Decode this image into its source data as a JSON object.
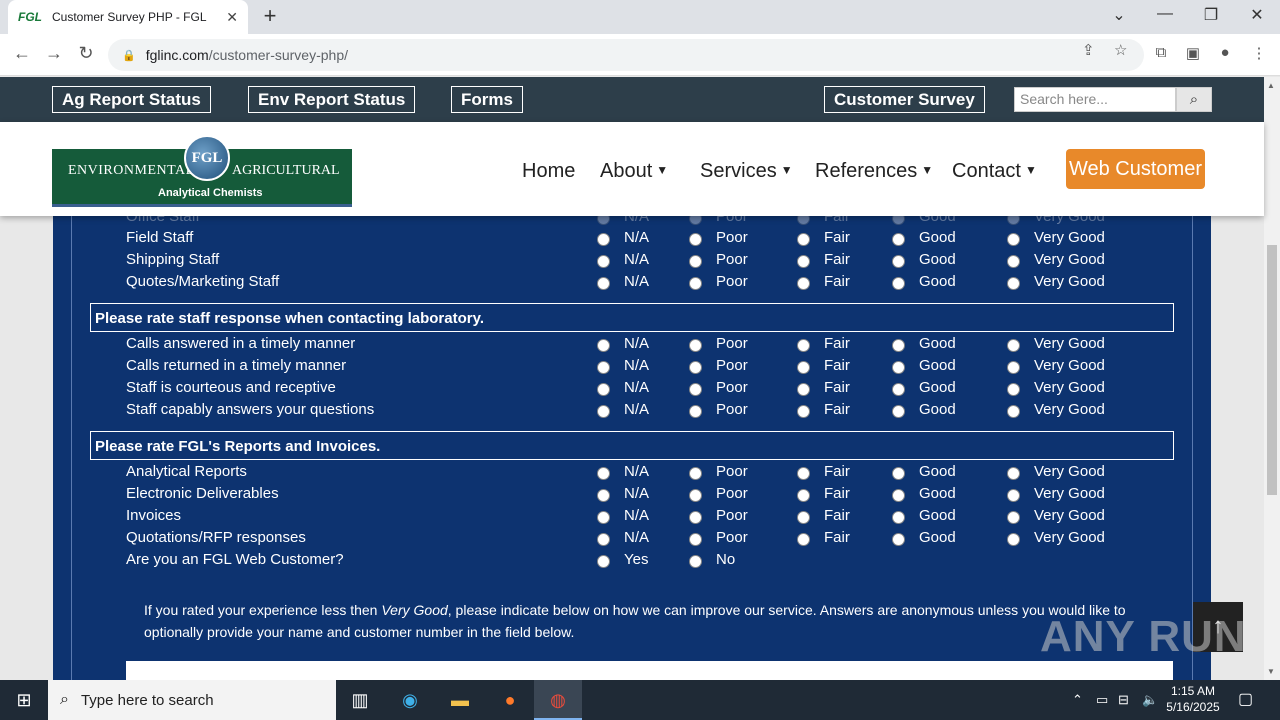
{
  "browser": {
    "tab_title": "Customer Survey PHP - FGL",
    "tab_favicon_text": "FGL",
    "url_domain": "fglinc.com",
    "url_path": "/customer-survey-php/"
  },
  "topbar": {
    "buttons": [
      "Ag Report Status",
      "Env Report Status",
      "Forms",
      "Customer Survey"
    ],
    "search_placeholder": "Search here..."
  },
  "header": {
    "logo": {
      "left": "ENVIRONMENTAL",
      "right": "AGRICULTURAL",
      "sub": "Analytical Chemists",
      "badge": "FGL"
    },
    "nav": [
      "Home",
      "About",
      "Services",
      "References",
      "Contact"
    ],
    "cta": "Web Customer"
  },
  "survey": {
    "options": [
      "N/A",
      "Poor",
      "Fair",
      "Good",
      "Very Good"
    ],
    "partial_row": {
      "label": "Office Staff"
    },
    "group1_rows": [
      "Field Staff",
      "Shipping Staff",
      "Quotes/Marketing Staff"
    ],
    "section2": "Please rate staff response when contacting laboratory.",
    "group2_rows": [
      "Calls answered in a timely manner",
      "Calls returned in a timely manner",
      "Staff is courteous and receptive",
      "Staff capably answers your questions"
    ],
    "section3": "Please rate FGL's Reports and Invoices.",
    "group3_rows": [
      "Analytical Reports",
      "Electronic Deliverables",
      "Invoices",
      "Quotations/RFP responses"
    ],
    "web_customer_q": "Are you an FGL Web Customer?",
    "yes_no": [
      "Yes",
      "No"
    ],
    "note_pre": "If you rated your experience less then ",
    "note_em": "Very Good",
    "note_post": ", please indicate below on how we can improve our service. Answers are anonymous unless you would like to optionally provide your name and customer number in the field below."
  },
  "watermark": "ANY RUN",
  "taskbar": {
    "search_placeholder": "Type here to search",
    "time": "1:15 AM",
    "date": "5/16/2025"
  }
}
